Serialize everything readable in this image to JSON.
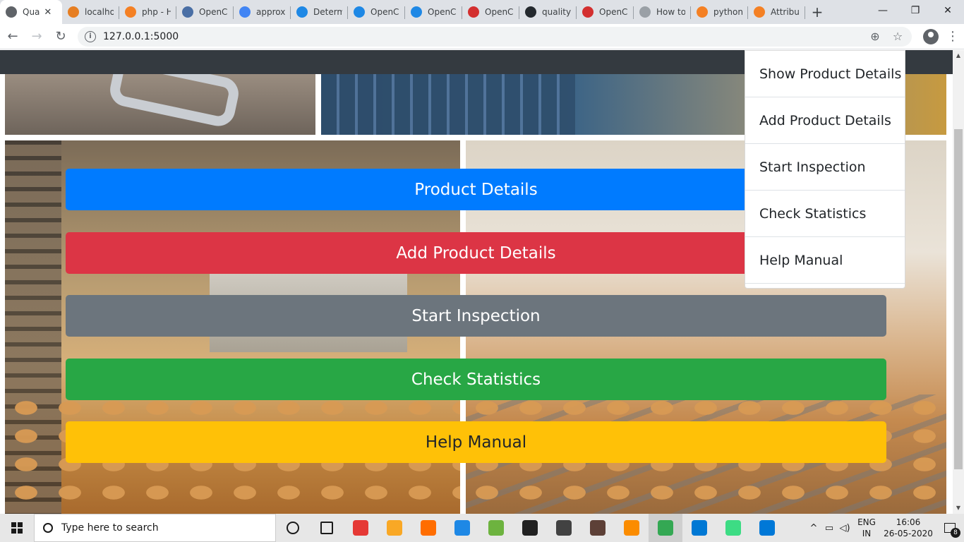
{
  "browser": {
    "tabs": [
      {
        "title": "Qua",
        "icon": "globe-icon",
        "color": "#5f6368",
        "active": true
      },
      {
        "title": "localho",
        "icon": "phpmyadmin-icon",
        "color": "#e67e22"
      },
      {
        "title": "php - H",
        "icon": "stackoverflow-icon",
        "color": "#f48024"
      },
      {
        "title": "OpenC",
        "icon": "opencv-icon",
        "color": "#4a6fa5"
      },
      {
        "title": "approxi",
        "icon": "google-icon",
        "color": "#4285f4"
      },
      {
        "title": "Determ",
        "icon": "pyimagesearch-icon",
        "color": "#1e88e5"
      },
      {
        "title": "OpenC",
        "icon": "pyimagesearch-icon",
        "color": "#1e88e5"
      },
      {
        "title": "OpenC",
        "icon": "pyimagesearch-icon",
        "color": "#1e88e5"
      },
      {
        "title": "OpenC",
        "icon": "opencv-icon",
        "color": "#d32f2f"
      },
      {
        "title": "quality-",
        "icon": "github-icon",
        "color": "#24292e"
      },
      {
        "title": "OpenC",
        "icon": "opencv-icon",
        "color": "#d32f2f"
      },
      {
        "title": "How to",
        "icon": "generic-icon",
        "color": "#9aa0a6"
      },
      {
        "title": "python",
        "icon": "stackoverflow-icon",
        "color": "#f48024"
      },
      {
        "title": "Attribut",
        "icon": "stackoverflow-icon",
        "color": "#f48024"
      }
    ],
    "new_tab_symbol": "+",
    "window_controls": {
      "minimize": "—",
      "maximize": "❐",
      "close": "✕"
    },
    "url": "127.0.0.1:5000",
    "info_symbol": "i"
  },
  "app": {
    "buttons": {
      "product_details": "Product Details",
      "add_product_details": "Add Product Details",
      "start_inspection": "Start Inspection",
      "check_statistics": "Check Statistics",
      "help_manual": "Help Manual"
    },
    "dropdown": [
      "Show Product Details",
      "Add Product Details",
      "Start Inspection",
      "Check Statistics",
      "Help Manual"
    ],
    "colors": {
      "primary": "#007bff",
      "danger": "#dc3545",
      "secondary": "#6c757d",
      "success": "#28a745",
      "warning": "#ffc107",
      "navbar": "#343a40"
    }
  },
  "taskbar": {
    "search_placeholder": "Type here to search",
    "apps": [
      {
        "name": "task-view-icon"
      },
      {
        "name": "task-manager-icon"
      },
      {
        "name": "media-icon",
        "color": "#e53935"
      },
      {
        "name": "file-explorer-icon",
        "color": "#f9a825"
      },
      {
        "name": "firefox-icon",
        "color": "#ff6d00"
      },
      {
        "name": "safari-icon",
        "color": "#1e88e5"
      },
      {
        "name": "spring-icon",
        "color": "#6db33f"
      },
      {
        "name": "terminal-icon",
        "color": "#212121"
      },
      {
        "name": "network-icon",
        "color": "#424242"
      },
      {
        "name": "virtualbox-icon",
        "color": "#5d4037"
      },
      {
        "name": "xampp-icon",
        "color": "#fb8c00"
      },
      {
        "name": "chrome-icon",
        "color": "#34a853",
        "active": true
      },
      {
        "name": "vscode-icon",
        "color": "#0078d4"
      },
      {
        "name": "android-studio-icon",
        "color": "#3ddc84"
      },
      {
        "name": "edge-icon",
        "color": "#0078d7"
      }
    ],
    "language": {
      "line1": "ENG",
      "line2": "IN"
    },
    "clock": {
      "time": "16:06",
      "date": "26-05-2020"
    },
    "notification_count": "8"
  }
}
